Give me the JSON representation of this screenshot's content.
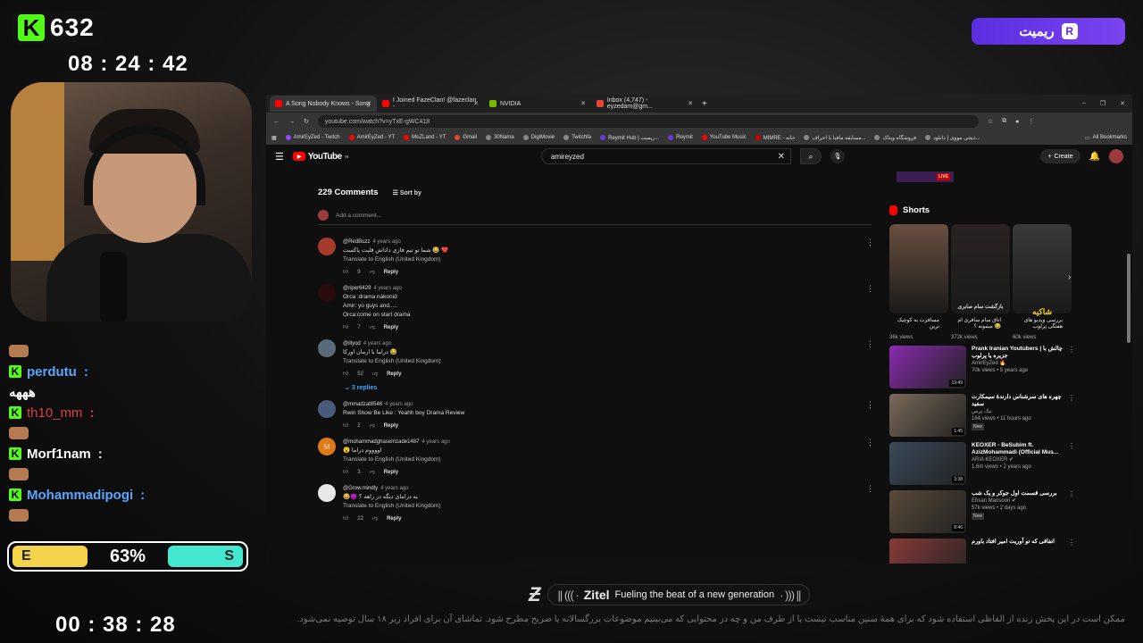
{
  "overlay": {
    "kick_letter": "K",
    "viewers": "632",
    "clock_top": "08 : 24 : 42",
    "clock_bottom": "00 : 38 : 28",
    "sponsor_label": "ریمیت",
    "sponsor_icon_letter": "R",
    "chat": [
      {
        "user": "perdutu",
        "color": "#5aa6ff",
        "msg": ""
      },
      {
        "user": "",
        "color": "#ffffff",
        "msg": "هههه"
      },
      {
        "user": "th10_mm",
        "color": "#e03a4a",
        "msg": ""
      },
      {
        "user": "Morf1nam",
        "color": "#ffffff",
        "msg": ""
      },
      {
        "user": "Mohammadipogi",
        "color": "#5aa6ff",
        "msg": ""
      }
    ],
    "vote": {
      "left": "E",
      "percent": "63%",
      "right": "S",
      "fill_percent": 63
    },
    "zitel": {
      "brand": "Zitel",
      "tagline": "Fueling the beat of a new generation",
      "bars_left": "|| ((( ·",
      "bars_right": "· ))) ||"
    },
    "disclaimer": "ممکن است در این پخش زنده از الفاظی استفاده شود که برای همهٔ سنین مناسب نیست یا از طرف من و چه در محتوایی که می‌بینیم موضوعات بزرگسالانه یا صریح مطرح شود. تماشای آن برای افراد زیر ۱۸ سال توصیه نمی‌شود."
  },
  "browser": {
    "tabs": [
      {
        "title": "A Song Nobody Knows - Song",
        "fav": "#f00"
      },
      {
        "title": "I Joined FazeClan! @fazeclan -",
        "fav": "#f00"
      },
      {
        "title": "NVIDIA",
        "fav": "#76b900"
      },
      {
        "title": "Inbox (4,747) - eyzedam@gm...",
        "fav": "#ea4335"
      }
    ],
    "new_tab": "+",
    "url": "youtube.com/watch?v=yTxE-gWC418",
    "bookmarks": [
      "AmirEyZed - Twitch",
      "AmirEyZed - YT",
      "MoZLand - YT",
      "Gmail",
      "30Nama",
      "DigiMovie",
      "Twitchfa",
      "Reymit Hub | ریمیت...",
      "Reymit",
      "YouTube Music",
      "MIMRE - خانه",
      "مسابقه مافیا با اخراف...",
      "فروشگاه ویتاک",
      "دیجی مووی | دانلود...",
      "All Bookmarks"
    ]
  },
  "youtube": {
    "logo": "YouTube",
    "logo_sup": "TR",
    "search_value": "amireyzed",
    "create_label": "Create",
    "comments_count": "229 Comments",
    "sort_label": "Sort by",
    "add_comment": "Add a comment...",
    "comments": [
      {
        "user": "@RedBuzz",
        "ago": "4 years ago",
        "lines": [
          "شما تو تیم فازی داداش قلبت پاکست 😂 ❤️"
        ],
        "translate": "Translate to English (United Kingdom)",
        "likes": "9",
        "avatar": "#a43a2a"
      },
      {
        "user": "@riper6429",
        "ago": "4 years ago",
        "lines": [
          "Orca :drama nakonid",
          "Amir: yo guys and.....",
          "Orca:come on start drama"
        ],
        "translate": "",
        "likes": "7",
        "avatar": "#2a0a0a"
      },
      {
        "user": "@illyod",
        "ago": "4 years ago",
        "lines": [
          "دراما با ارمان اورکا 😂"
        ],
        "translate": "Translate to English (United Kingdom)",
        "likes": "52",
        "avatar": "#5a6a7a"
      },
      {
        "user": "@mmadzat8546",
        "ago": "4 years ago",
        "lines": [
          "Rwin Show Be Like : Yeahh boy Drama Review"
        ],
        "translate": "",
        "likes": "2",
        "avatar": "#4a5a7a"
      },
      {
        "user": "@mohammadghasemzade1487",
        "ago": "4 years ago",
        "lines": [
          "😮 اووووم دراما"
        ],
        "translate": "Translate to English (United Kingdom)",
        "likes": "3",
        "avatar": "#e07a18",
        "initial": "M"
      },
      {
        "user": "@Grow.mindly",
        "ago": "4 years ago",
        "lines": [
          "😂😈 یه درامای دیگه در راهه ؟"
        ],
        "translate": "Translate to English (United Kingdom)",
        "likes": "22",
        "avatar": "#e8e8e8"
      }
    ],
    "replies_label": "3 replies",
    "reply_label": "Reply",
    "live_badge": "LIVE",
    "shorts_title": "Shorts",
    "shorts": [
      {
        "title": "مسافرت به کوچیک ترین",
        "views": "36k views",
        "color": "#6a5040"
      },
      {
        "title": "اتاق سام سافری ام میمونه ؟ 😂",
        "views": "372k views",
        "color": "#2a2222"
      },
      {
        "title": "بررسی ویدیو های هفتگی پرلوب",
        "views": "60k views",
        "color": "#3a3a3a"
      }
    ],
    "shorts_overlay_1": "بازگشت سام صابری",
    "shorts_overlay_2": "شاکیه",
    "videos": [
      {
        "title": "Prank Iranian Youtubers | چالش با جزیره یا پرلوب",
        "channel": "AmirEyZed 🔥",
        "meta": "70k views • 5 years ago",
        "dur": "19:49",
        "color": "#8a2ab0",
        "new": ""
      },
      {
        "title": "چهره های سرشناس دارندۀ سیمکارت سفید",
        "channel": "تیک پرس",
        "meta": "164 views • 11 hours ago",
        "dur": "1:45",
        "color": "#7a6a5a",
        "new": "New"
      },
      {
        "title": "KEOXER - BeSubim ft. AzizMohammadi (Official Mus...",
        "channel": "ARIA KEOXER ✔",
        "meta": "1.6m views • 2 years ago",
        "dur": "3:38",
        "color": "#3a4a5a",
        "new": ""
      },
      {
        "title": "بررسی قسمت اول جوکر و یک شب",
        "channel": "Ehsan Mansoori ✔",
        "meta": "57k views • 2 days ago",
        "dur": "8:46",
        "color": "#5a4a3a",
        "new": "New"
      },
      {
        "title": "اتفاقی که تو آوریت امیر افتاد باورم",
        "channel": "",
        "meta": "",
        "dur": "",
        "color": "#8a3a3a",
        "new": ""
      }
    ]
  }
}
